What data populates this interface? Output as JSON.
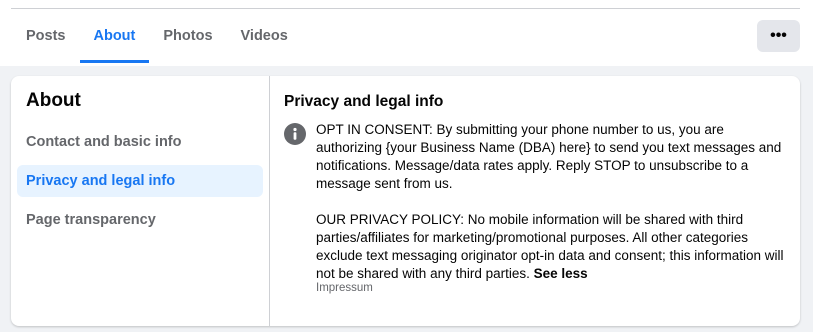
{
  "nav": {
    "tabs": [
      {
        "label": "Posts"
      },
      {
        "label": "About"
      },
      {
        "label": "Photos"
      },
      {
        "label": "Videos"
      }
    ],
    "more_label": "•••"
  },
  "sidebar": {
    "title": "About",
    "items": [
      {
        "label": "Contact and basic info"
      },
      {
        "label": "Privacy and legal info"
      },
      {
        "label": "Page transparency"
      }
    ]
  },
  "content": {
    "section_title": "Privacy and legal info",
    "icon": "info-icon",
    "consent_text": "OPT IN CONSENT: By submitting your phone number to us, you are authorizing {your Business Name (DBA) here} to send you text messages and notifications. Message/data rates apply. Reply STOP to unsubscribe to a message sent from us.",
    "policy_text": "OUR PRIVACY POLICY: No mobile information will be shared with third parties/affiliates for marketing/promotional purposes. All other categories exclude text messaging originator opt-in data and consent; this information will not be shared with any third parties.",
    "see_less": "See less",
    "impressum": "Impressum"
  },
  "colors": {
    "accent": "#1877f2",
    "active_bg": "#e7f3ff",
    "secondary_text": "#65676b"
  }
}
